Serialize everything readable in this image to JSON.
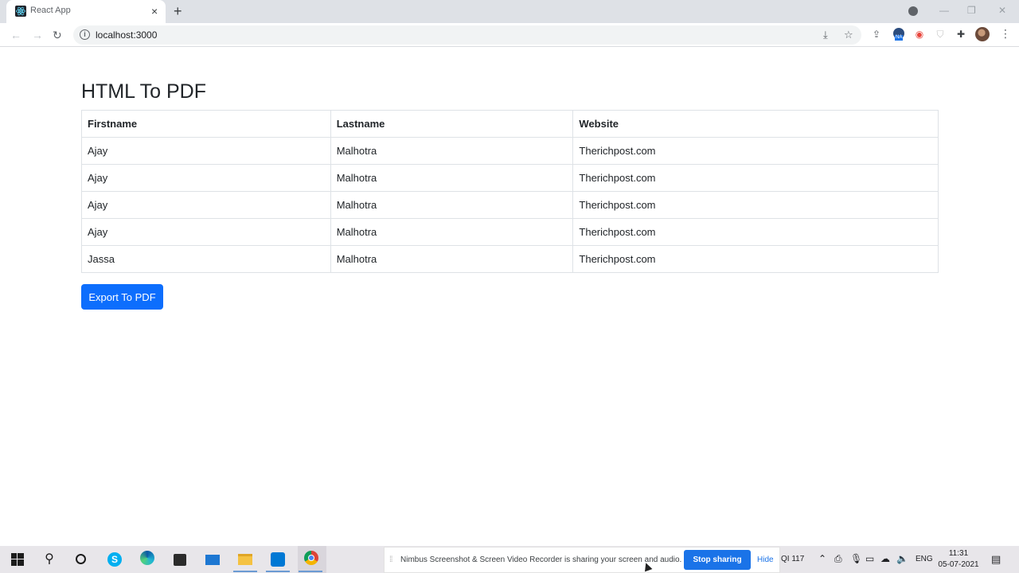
{
  "browser": {
    "tab_title": "React App",
    "tab_close": "×",
    "new_tab": "+",
    "url": "localhost:3000",
    "info_glyph": "i",
    "ext_na_badge": "NA"
  },
  "page": {
    "title": "HTML To PDF",
    "table": {
      "headers": [
        "Firstname",
        "Lastname",
        "Website"
      ],
      "rows": [
        [
          "Ajay",
          "Malhotra",
          "Therichpost.com"
        ],
        [
          "Ajay",
          "Malhotra",
          "Therichpost.com"
        ],
        [
          "Ajay",
          "Malhotra",
          "Therichpost.com"
        ],
        [
          "Ajay",
          "Malhotra",
          "Therichpost.com"
        ],
        [
          "Jassa",
          "Malhotra",
          "Therichpost.com"
        ]
      ]
    },
    "export_button": "Export To PDF"
  },
  "sharing": {
    "message": "Nimbus Screenshot & Screen Video Recorder is sharing your screen and audio.",
    "stop_button": "Stop sharing",
    "hide_link": "Hide"
  },
  "taskbar": {
    "aqi": "QI 117",
    "language": "ENG",
    "time": "11:31",
    "date": "05-07-2021"
  },
  "colors": {
    "primary_button": "#0d6efd",
    "stop_button": "#1a73e8",
    "tab_strip": "#dee1e6"
  }
}
